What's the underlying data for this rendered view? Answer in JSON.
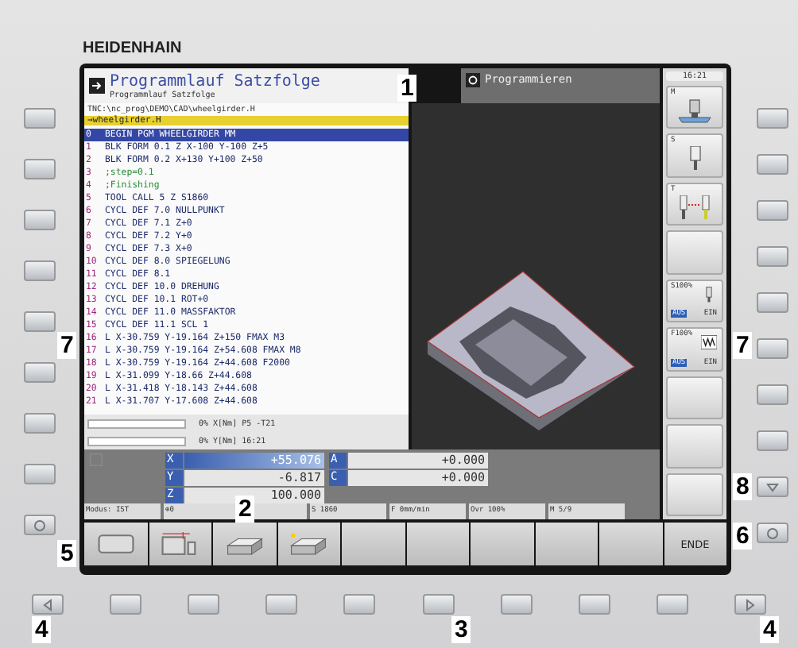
{
  "brand": "HEIDENHAIN",
  "header": {
    "title": "Programmlauf Satzfolge",
    "subtitle": "Programmlauf Satzfolge",
    "mode": "Programmieren",
    "time": "16:21"
  },
  "program": {
    "path": "TNC:\\nc_prog\\DEMO\\CAD\\wheelgirder.H",
    "file": "→wheelgirder.H",
    "lines": [
      {
        "num": "0",
        "text": "BEGIN PGM WHEELGIRDER MM",
        "kind": "code",
        "selected": true
      },
      {
        "num": "1",
        "text": "BLK FORM 0.1 Z X-100 Y-100 Z+5",
        "kind": "code",
        "selected": false
      },
      {
        "num": "2",
        "text": "BLK FORM 0.2  X+130  Y+100  Z+50",
        "kind": "code",
        "selected": false
      },
      {
        "num": "3",
        "text": ";step=0.1",
        "kind": "comment",
        "selected": false
      },
      {
        "num": "4",
        "text": ";Finishing",
        "kind": "comment",
        "selected": false
      },
      {
        "num": "5",
        "text": "TOOL CALL 5 Z S1860",
        "kind": "code",
        "selected": false
      },
      {
        "num": "6",
        "text": "CYCL DEF 7.0 NULLPUNKT",
        "kind": "code",
        "selected": false
      },
      {
        "num": "7",
        "text": "CYCL DEF 7.1  Z+0",
        "kind": "code",
        "selected": false
      },
      {
        "num": "8",
        "text": "CYCL DEF 7.2  Y+0",
        "kind": "code",
        "selected": false
      },
      {
        "num": "9",
        "text": "CYCL DEF 7.3  X+0",
        "kind": "code",
        "selected": false
      },
      {
        "num": "10",
        "text": "CYCL DEF 8.0 SPIEGELUNG",
        "kind": "code",
        "selected": false
      },
      {
        "num": "11",
        "text": "CYCL DEF 8.1",
        "kind": "code",
        "selected": false
      },
      {
        "num": "12",
        "text": "CYCL DEF 10.0 DREHUNG",
        "kind": "code",
        "selected": false
      },
      {
        "num": "13",
        "text": "CYCL DEF 10.1  ROT+0",
        "kind": "code",
        "selected": false
      },
      {
        "num": "14",
        "text": "CYCL DEF 11.0 MASSFAKTOR",
        "kind": "code",
        "selected": false
      },
      {
        "num": "15",
        "text": "CYCL DEF 11.1 SCL 1",
        "kind": "code",
        "selected": false
      },
      {
        "num": "16",
        "text": "L  X-30.759  Y-19.164  Z+150 FMAX M3",
        "kind": "code",
        "selected": false
      },
      {
        "num": "17",
        "text": "L  X-30.759  Y-19.164  Z+54.608 FMAX M8",
        "kind": "code",
        "selected": false
      },
      {
        "num": "18",
        "text": "L  X-30.759  Y-19.164  Z+44.608 F2000",
        "kind": "code",
        "selected": false
      },
      {
        "num": "19",
        "text": "L  X-31.099  Y-18.66  Z+44.608",
        "kind": "code",
        "selected": false
      },
      {
        "num": "20",
        "text": "L  X-31.418  Y-18.143  Z+44.608",
        "kind": "code",
        "selected": false
      },
      {
        "num": "21",
        "text": "L  X-31.707  Y-17.608  Z+44.608",
        "kind": "code",
        "selected": false
      }
    ],
    "progress": [
      {
        "level": 0,
        "text": "0% X[Nm] P5  -T21"
      },
      {
        "level": 0,
        "text": "0% Y[Nm] 16:21"
      }
    ]
  },
  "side_panel": [
    {
      "kind": "spindle-head",
      "label": "M"
    },
    {
      "kind": "spindle",
      "label": "S"
    },
    {
      "kind": "tool-change",
      "label": "T"
    },
    {
      "kind": "blank"
    },
    {
      "kind": "override",
      "label": "S100%",
      "off": "AUS",
      "on": "EIN",
      "enabled": false
    },
    {
      "kind": "override-feed",
      "label": "F100%",
      "off": "AUS",
      "on": "EIN",
      "enabled": false
    },
    {
      "kind": "blank"
    },
    {
      "kind": "blank"
    },
    {
      "kind": "blank"
    }
  ],
  "positions": [
    {
      "axis": "X",
      "value": "+55.076",
      "selected": true
    },
    {
      "axis": "A",
      "value": "+0.000",
      "selected": false
    },
    {
      "axis": "Y",
      "value": "-6.817",
      "selected": false
    },
    {
      "axis": "C",
      "value": "+0.000",
      "selected": false
    },
    {
      "axis": "Z",
      "value": "100.000",
      "selected": false
    }
  ],
  "status_bar": [
    "Modus: IST",
    "⊕0",
    "S 1860",
    "F 0mm/min",
    "Ovr 100%",
    "M 5/9"
  ],
  "softkeys": [
    {
      "kind": "frame"
    },
    {
      "kind": "table"
    },
    {
      "kind": "block"
    },
    {
      "kind": "block-dot"
    },
    {
      "kind": "blank"
    },
    {
      "kind": "blank"
    },
    {
      "kind": "blank"
    },
    {
      "kind": "blank"
    },
    {
      "kind": "blank"
    },
    {
      "kind": "text",
      "label": "ENDE"
    }
  ],
  "callouts": [
    "1",
    "7",
    "7",
    "8",
    "2",
    "6",
    "5",
    "4",
    "3",
    "4"
  ]
}
